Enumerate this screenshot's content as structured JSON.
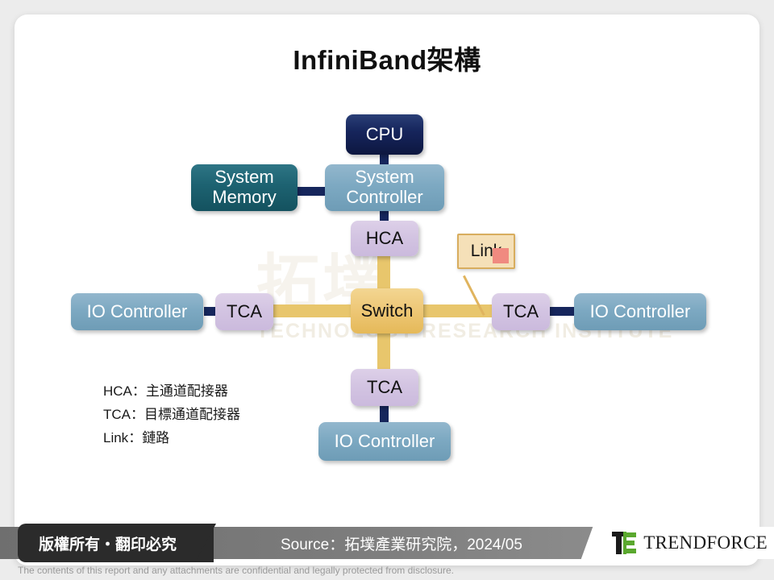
{
  "slide": {
    "title": "InfiniBand架構"
  },
  "watermark": {
    "cjk": "拓墣",
    "english": "TECHNOLOGY RESEARCH INSTITUTE"
  },
  "diagram": {
    "nodes": {
      "cpu": "CPU",
      "system_memory": "System\nMemory",
      "system_memory_line1": "System",
      "system_memory_line2": "Memory",
      "system_controller_line1": "System",
      "system_controller_line2": "Controller",
      "hca": "HCA",
      "link": "Link",
      "switch": "Switch",
      "tca_left": "TCA",
      "tca_right": "TCA",
      "tca_bottom": "TCA",
      "io_controller_left": "IO Controller",
      "io_controller_right": "IO Controller",
      "io_controller_bottom": "IO Controller"
    },
    "colors": {
      "cpu": "#16255c",
      "system_memory": "#1d6271",
      "controller": "#7da9c2",
      "adapter": "#d3c4e2",
      "switch": "#eec878",
      "link_box": "#f5e0b8",
      "link_swatch": "#f08a80",
      "line_navy": "#16265c",
      "line_gold": "#e8c66c"
    }
  },
  "legend": [
    {
      "key": "HCA",
      "sep": "：",
      "value": "主通道配接器"
    },
    {
      "key": "TCA",
      "sep": "：",
      "value": "目標通道配接器"
    },
    {
      "key": "Link",
      "sep": "：",
      "value": "鏈路"
    }
  ],
  "footer": {
    "copyright_badge": "版權所有・翻印必究",
    "source": "Source：拓墣產業研究院，2024/05",
    "brand_name": "TRENDFORCE",
    "disclaimer": "The contents of this report and any attachments are confidential and legally protected from disclosure."
  }
}
